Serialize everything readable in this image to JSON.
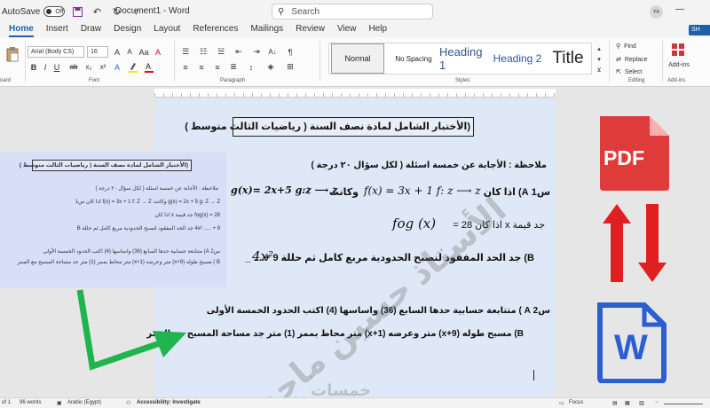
{
  "titlebar": {
    "autosave_label": "AutoSave",
    "autosave_state": "Off",
    "doc_title": "Document1 - Word",
    "search_placeholder": "Search",
    "user_initials": "YA"
  },
  "tabs": [
    "Home",
    "Insert",
    "Draw",
    "Design",
    "Layout",
    "References",
    "Mailings",
    "Review",
    "View",
    "Help"
  ],
  "share_label": "SH",
  "ribbon": {
    "font_name": "Arial (Body CS)",
    "font_size": "16",
    "group_clipboard": "oard",
    "group_font": "Font",
    "group_paragraph": "Paragraph",
    "group_styles": "Styles",
    "group_editing": "Editing",
    "group_addins": "Add-ins",
    "styles": [
      "Normal",
      "No Spacing",
      "Heading 1",
      "Heading 2",
      "Title"
    ],
    "find": "Find",
    "replace": "Replace",
    "select": "Select",
    "addins_label": "Add-ins"
  },
  "document": {
    "title_box": "(الأختبار الشامل لمادة نصف السنة ( رياضيات الثالث متوسط )",
    "note": "ملاحظة : الأجابة عن خمسة اسئلة ( لكل سؤال ٢٠ درجة )",
    "q1a_label": "س1 A) اذا كان",
    "q1a_math1": "f(x) = 3x + 1  f: z ⟶ z",
    "q1a_and": "وكانت",
    "q1a_math2": "g(x)= 2x+5   g:z ⟶ z",
    "q1a_find": "جد قيمة x اذا كان 28 =",
    "q1a_fog": "fog (x)",
    "q1b": "B) جد الحد المفقود لتصبح الحدودية مربع كامل ثم حللة 9 +.... _",
    "q1b_math": "4x²",
    "q2a": "س2 A ) متتابعة حسابية حدها السابع (36) واساسها (4) اكتب الحدود الخمسة الأولى",
    "q2b": "B) مسبح طوله (x+9) متر وعرضه (x+1) متر محاط بممر (1) متر جد مساحة المسبح مع الممر"
  },
  "thumbnail": {
    "title": "(الأختبار الشامل لمادة نصف السنة ( رياضيات الثالث متوسط )",
    "line1": "ملاحظة : الأجابة عن خمسة اسئلة ( لكل سؤال ٢٠ درجة )",
    "line2": "g(x) = 2x + 5   g: Z → Z  وكانت  f(x) = 3x + 1  f: Z → Z  اذا كان  س1",
    "line3": "fog(x) = 28  جد قيمة x اذا كان",
    "line4": "4x² ..... + 9  جد الحد المفقود لتصبح الحدودية مربع كامل ثم حللة B",
    "line5": "س2 A) متتابعة حسابية حدها السابع (36) واساسها (4) اكتب الحدود الخمسة الأولى",
    "line6": "B ) مسبح طوله (x+9) متر وعرضه (x+1) متر محاط بممر (1) متر جد مساحة المسبح مع الممر"
  },
  "watermark": {
    "main": "الأستاذ حسين ماجد",
    "footer": "خمسات"
  },
  "side": {
    "pdf_label": "PDF",
    "word_letter": "W"
  },
  "status": {
    "page": "of 1",
    "words": "96 words",
    "language": "Arabic (Egypt)",
    "accessibility": "Accessibility: Investigate",
    "focus": "Focus"
  },
  "colors": {
    "accent": "#1f5fa8",
    "pdf_red": "#e03b3b",
    "arrow_red": "#e02020",
    "arrow_green": "#1fb44e",
    "word_blue": "#2b5fd0"
  }
}
